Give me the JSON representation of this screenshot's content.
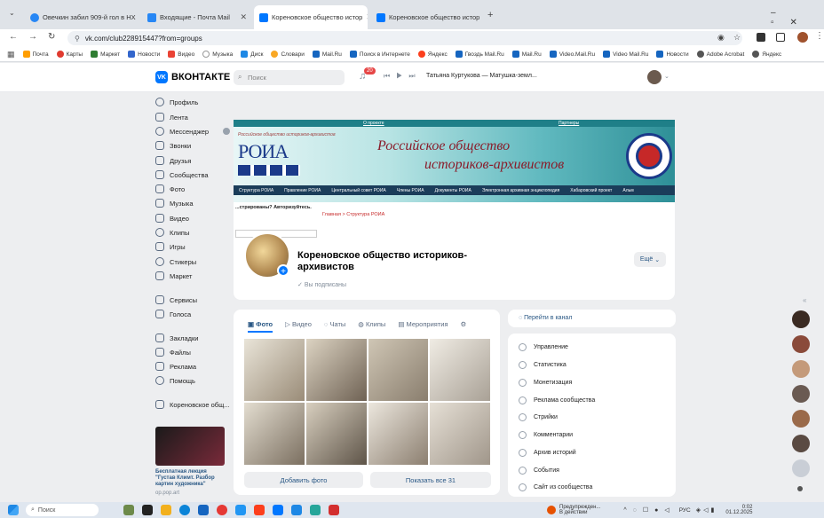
{
  "browser": {
    "tabs": [
      {
        "label": "Овечкин забил 909-й гол в НХ"
      },
      {
        "label": "Входящие - Почта Mail"
      },
      {
        "label": "Кореновское общество истор"
      },
      {
        "label": "Кореновское общество истор"
      }
    ],
    "address": "vk.com/club228915447?from=groups",
    "bookmarks": [
      "Почта",
      "Карты",
      "Маркет",
      "Новости",
      "Видео",
      "Музыка",
      "Диск",
      "Словари",
      "Mail.Ru",
      "Поиск в Интернете",
      "Яндекс",
      "Гвоздь Mail.Ru",
      "Mail.Ru",
      "Video.Mail.Ru",
      "Video Mail.Ru",
      "Новости",
      "Adobe Acrobat",
      "Яндекс"
    ]
  },
  "vk": {
    "logo": "ВКОНТАКТЕ",
    "logo_badge": "VK",
    "search_placeholder": "Поиск",
    "notif_count": "20",
    "player_track": "Татьяна Куртукова — Матушка-земл..."
  },
  "nav": {
    "items": [
      {
        "label": "Профиль"
      },
      {
        "label": "Лента"
      },
      {
        "label": "Мессенджер"
      },
      {
        "label": "Звонки"
      },
      {
        "label": "Друзья"
      },
      {
        "label": "Сообщества"
      },
      {
        "label": "Фото"
      },
      {
        "label": "Музыка"
      },
      {
        "label": "Видео"
      },
      {
        "label": "Клипы"
      },
      {
        "label": "Игры"
      },
      {
        "label": "Стикеры"
      },
      {
        "label": "Маркет"
      }
    ],
    "items2": [
      {
        "label": "Сервисы"
      },
      {
        "label": "Голоса"
      }
    ],
    "items3": [
      {
        "label": "Закладки"
      },
      {
        "label": "Файлы"
      },
      {
        "label": "Реклама"
      },
      {
        "label": "Помощь"
      }
    ],
    "group_shortcut": "Кореновское общ..."
  },
  "ad": {
    "title": "Бесплатная лекция \"Густав Климт. Разбор картин художника\"",
    "domain": "op.pop.art"
  },
  "cover": {
    "top_links": [
      "О проекте",
      "Партнеры"
    ],
    "logo_text": "РОИА",
    "logo_small": "Российское общество историков-архивистов",
    "title_line1": "Российское общество",
    "title_line2": "историков-архивистов",
    "menu": [
      "Структура РОИА",
      "Правление РОИА",
      "Центральный совет РОИА",
      "Члены РОИА",
      "Документы РОИА",
      "Электронная архивная энциклопедия",
      "Хабаровский проект",
      "Альм"
    ],
    "auth_prompt": "...стрированы? Авторизуйтесь.",
    "breadcrumb": "Главная > Структура РОИА"
  },
  "group": {
    "name": "Кореновское общество историков-архивистов",
    "subscribed": "Вы подписаны",
    "more_button": "Ещё"
  },
  "photos": {
    "tabs": [
      "Фото",
      "Видео",
      "Чаты",
      "Клипы",
      "Мероприятия"
    ],
    "add_button": "Добавить фото",
    "show_all": "Показать все 31"
  },
  "rightcol": {
    "channel": "Перейти в канал",
    "items": [
      "Управление",
      "Статистика",
      "Монетизация",
      "Реклама сообщества",
      "Стрийки",
      "Комментарии",
      "Архив историй",
      "События",
      "Сайт из сообщества"
    ]
  },
  "taskbar": {
    "search": "Поиск",
    "weather": "Предупрежден...",
    "weather_sub": "В действии",
    "lang": "РУС",
    "time": "0:02",
    "date": "01.12.2025"
  }
}
